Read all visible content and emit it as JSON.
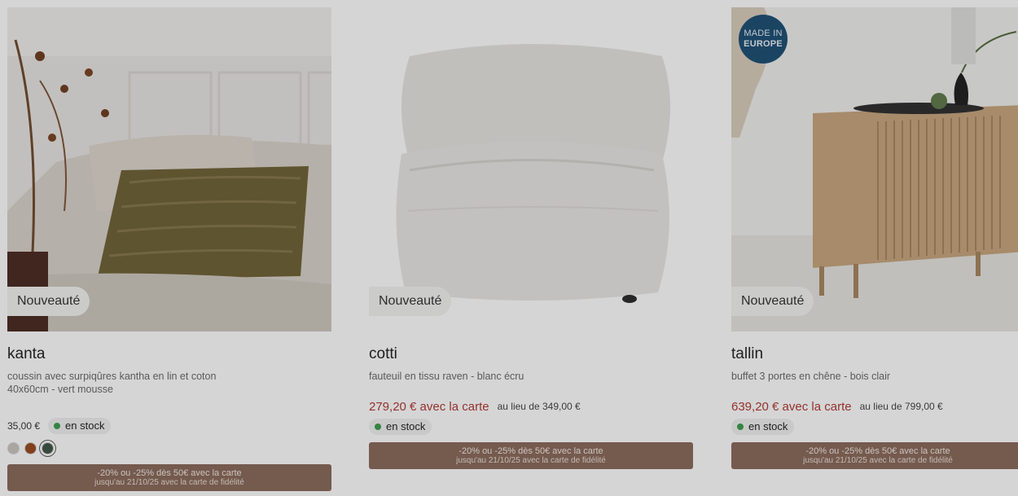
{
  "products": [
    {
      "badge": "Nouveauté",
      "name": "kanta",
      "desc_line1": "coussin avec surpiqûres kantha en lin et coton",
      "desc_line2": "40x60cm - vert mousse",
      "price": "35,00 €",
      "stock": "en stock",
      "swatches": [
        "#c9c6bf",
        "#9a4a1e",
        "#3f5446"
      ],
      "promo_line1": "-20% ou -25% dès 50€ avec la carte",
      "promo_line2": "jusqu'au 21/10/25 avec la carte de fidélité",
      "image_icon": "cushion-on-sofa-photo"
    },
    {
      "badge": "Nouveauté",
      "name": "cotti",
      "desc_line1": "fauteuil en tissu raven - blanc écru",
      "promo_price": "279,20 € avec la carte",
      "old_price": "au lieu de 349,00 €",
      "stock": "en stock",
      "promo_line1": "-20% ou -25% dès 50€ avec la carte",
      "promo_line2": "jusqu'au 21/10/25 avec la carte de fidélité",
      "image_icon": "armchair-photo"
    },
    {
      "badge": "Nouveauté",
      "made_line1": "MADE IN",
      "made_line2": "EUROPE",
      "name": "tallin",
      "desc_line1": "buffet 3 portes en chêne - bois clair",
      "promo_price": "639,20 € avec la carte",
      "old_price": "au lieu de 799,00 €",
      "stock": "en stock",
      "promo_line1": "-20% ou -25% dès 50€ avec la carte",
      "promo_line2": "jusqu'au 21/10/25 avec la carte de fidélité",
      "image_icon": "sideboard-photo"
    }
  ],
  "colors": {
    "promo_price": "#b0392f",
    "promo_bar": "#8a6a59",
    "stock_dot": "#3c9d4e",
    "made_badge": "#1d4f73"
  }
}
